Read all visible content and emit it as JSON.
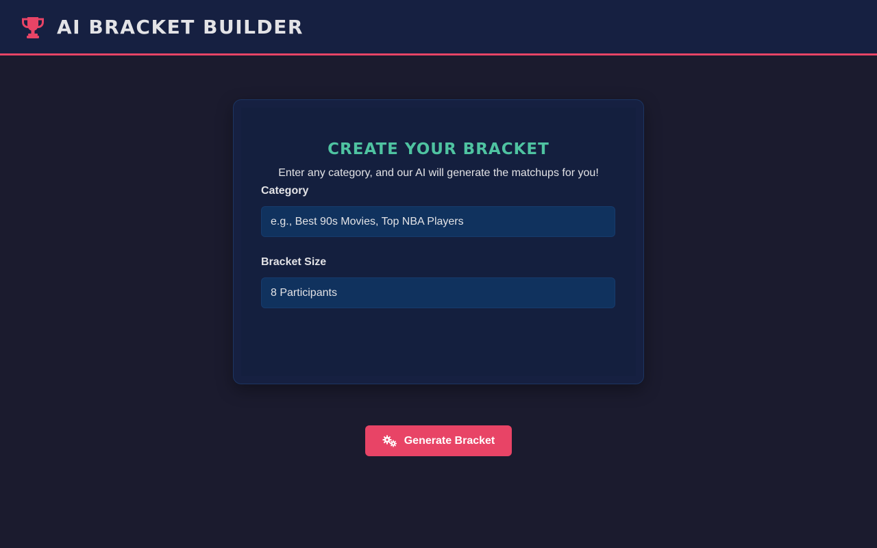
{
  "header": {
    "app_title": "AI Bracket Builder",
    "logo_icon": "trophy-icon",
    "accent_color": "#e84466"
  },
  "form": {
    "title": "Create Your Bracket",
    "subtitle": "Enter any category, and our AI will generate the matchups for you!",
    "category": {
      "label": "Category",
      "placeholder": "e.g., Best 90s Movies, Top NBA Players",
      "value": ""
    },
    "bracket_size": {
      "label": "Bracket Size",
      "selected": "8 Participants"
    },
    "generate_button": {
      "label": "Generate Bracket",
      "icon": "cogs-icon"
    }
  },
  "colors": {
    "background": "#1b1b2e",
    "header_bg": "#162041",
    "card_bg": "#141f3e",
    "input_bg": "#10325e",
    "title_green": "#4fc3a1",
    "button": "#e84466"
  }
}
